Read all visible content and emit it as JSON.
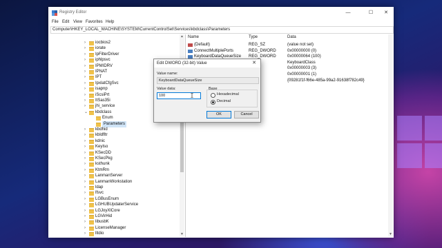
{
  "window": {
    "title": "Registry Editor",
    "controls": {
      "minimize": "—",
      "maximize": "☐",
      "close": "✕"
    }
  },
  "menu": [
    "File",
    "Edit",
    "View",
    "Favorites",
    "Help"
  ],
  "address": "Computer\\HKEY_LOCAL_MACHINE\\SYSTEM\\CurrentControlSet\\Services\\kbdclass\\Parameters",
  "tree": {
    "items": [
      {
        "label": "iocbios2",
        "expandable": true
      },
      {
        "label": "iorate",
        "expandable": true
      },
      {
        "label": "IpFilterDriver",
        "expandable": true
      },
      {
        "label": "iphlpsvc",
        "expandable": true
      },
      {
        "label": "IPMIDRV",
        "expandable": true
      },
      {
        "label": "IPNAT",
        "expandable": true
      },
      {
        "label": "IPT",
        "expandable": true
      },
      {
        "label": "IpxlatCfgSvc",
        "expandable": true
      },
      {
        "label": "isapnp",
        "expandable": true
      },
      {
        "label": "iScsiPrt",
        "expandable": true
      },
      {
        "label": "ItSas35i",
        "expandable": true
      },
      {
        "label": "jhi_service",
        "expandable": true
      },
      {
        "label": "kbdclass",
        "expandable": true,
        "expanded": true
      },
      {
        "label": "Enum",
        "expandable": false,
        "child": true
      },
      {
        "label": "Parameters",
        "expandable": false,
        "child": true,
        "selected": true
      },
      {
        "label": "kbdhid",
        "expandable": true
      },
      {
        "label": "kbldfltr",
        "expandable": true
      },
      {
        "label": "kdnic",
        "expandable": true
      },
      {
        "label": "KeyIso",
        "expandable": true
      },
      {
        "label": "KSecDD",
        "expandable": true
      },
      {
        "label": "KSecPkg",
        "expandable": true
      },
      {
        "label": "ksthunk",
        "expandable": true
      },
      {
        "label": "KtmRm",
        "expandable": true
      },
      {
        "label": "LanmanServer",
        "expandable": true
      },
      {
        "label": "LanmanWorkstation",
        "expandable": true
      },
      {
        "label": "ldap",
        "expandable": true
      },
      {
        "label": "lfsvc",
        "expandable": true
      },
      {
        "label": "LGBusEnum",
        "expandable": true
      },
      {
        "label": "LGHUBUpdaterService",
        "expandable": true
      },
      {
        "label": "LGJoyXlCore",
        "expandable": true
      },
      {
        "label": "LGVirHid",
        "expandable": true
      },
      {
        "label": "libusbK",
        "expandable": true
      },
      {
        "label": "LicenseManager",
        "expandable": true
      },
      {
        "label": "lltdio",
        "expandable": true
      },
      {
        "label": "lltdsvc",
        "expandable": true
      }
    ]
  },
  "list": {
    "columns": {
      "name": "Name",
      "type": "Type",
      "data": "Data"
    },
    "rows": [
      {
        "name": "(Default)",
        "type": "REG_SZ",
        "data": "(value not set)",
        "icon": "string-value-icon"
      },
      {
        "name": "ConnectMultiplePorts",
        "type": "REG_DWORD",
        "data": "0x00000000 (0)",
        "icon": "dword-value-icon"
      },
      {
        "name": "KeyboardDataQueueSize",
        "type": "REG_DWORD",
        "data": "0x00000064 (100)",
        "icon": "dword-value-icon"
      },
      {
        "name": "",
        "type": "",
        "data": "KeyboardClass",
        "icon": ""
      },
      {
        "name": "",
        "type": "",
        "data": "0x00000003 (3)",
        "icon": ""
      },
      {
        "name": "",
        "type": "",
        "data": "0x00000001 (1)",
        "icon": ""
      },
      {
        "name": "",
        "type": "",
        "data": "{09281f1f-f66e-485a-99a2-91638f782c49}",
        "icon": ""
      }
    ]
  },
  "dialog": {
    "title": "Edit DWORD (32-bit) Value",
    "close": "✕",
    "value_name_label": "Value name:",
    "value_name": "KeyboardDataQueueSize",
    "value_data_label": "Value data:",
    "value_data": "100",
    "base_label": "Base",
    "base_options": [
      {
        "label": "Hexadecimal",
        "checked": false
      },
      {
        "label": "Decimal",
        "checked": true
      }
    ],
    "ok": "OK",
    "cancel": "Cancel"
  },
  "colors": {
    "selection": "#cfe4f7",
    "folder": "#f0c24b",
    "focus_border": "#0078d7",
    "dword_icon": "#4a7fc1",
    "string_icon": "#c04a4a"
  }
}
